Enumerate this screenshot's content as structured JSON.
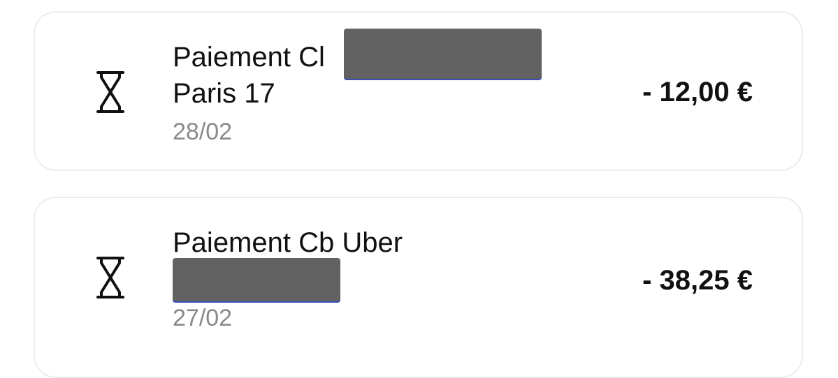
{
  "transactions": [
    {
      "title_line_1": "Paiement Cl",
      "title_line_2": "Paris 17",
      "date": "28/02",
      "amount": "- 12,00 €",
      "status_icon": "hourglass-icon"
    },
    {
      "title_line_1": "Paiement Cb Uber",
      "date": "27/02",
      "amount": "- 38,25 €",
      "status_icon": "hourglass-icon"
    }
  ],
  "colors": {
    "card_border": "#ececec",
    "text": "#111111",
    "date_text": "#8a8a8a",
    "redaction": "#626262"
  }
}
